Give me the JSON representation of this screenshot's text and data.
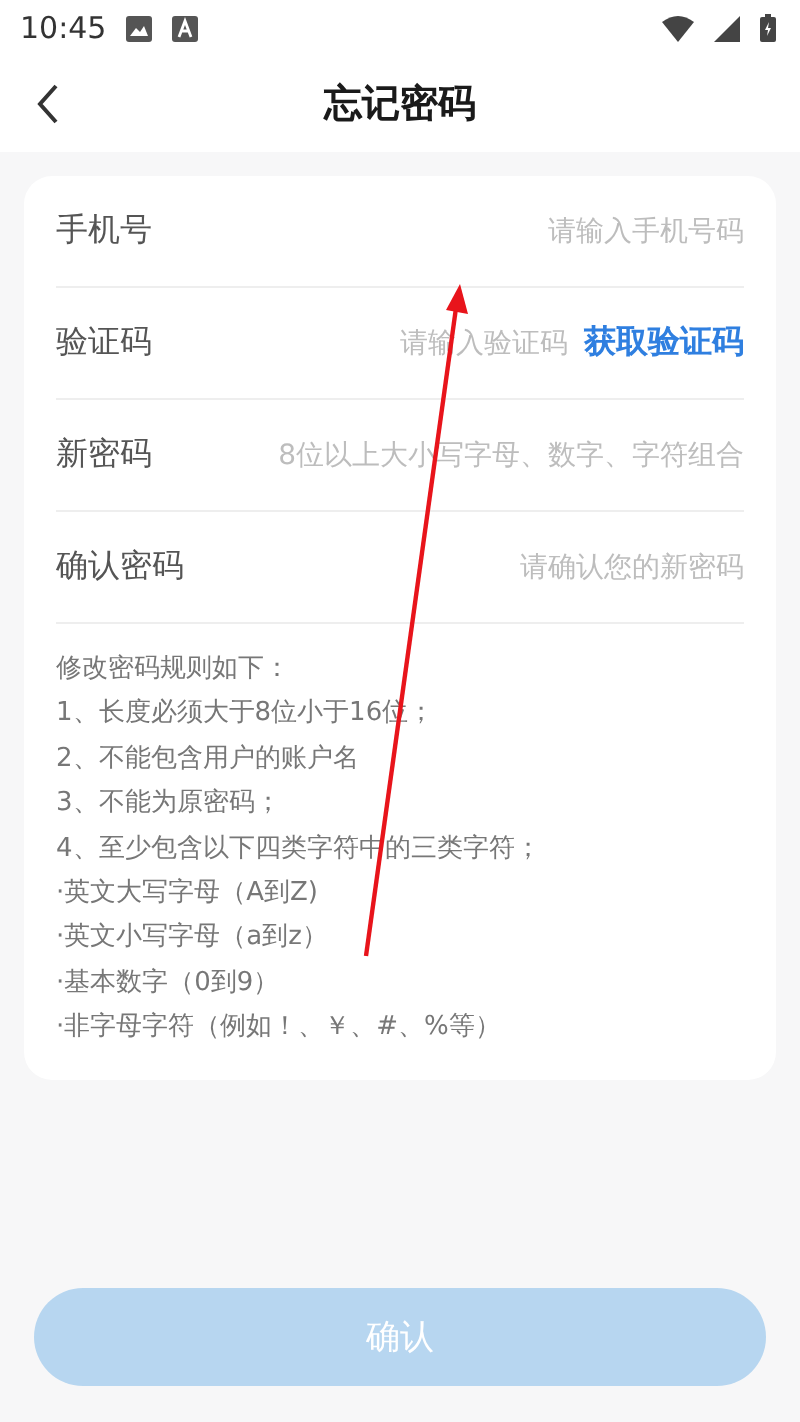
{
  "status_bar": {
    "time": "10:45"
  },
  "header": {
    "title": "忘记密码"
  },
  "fields": [
    {
      "kind": "text",
      "label": "手机号",
      "placeholder": "请输入手机号码"
    },
    {
      "kind": "code",
      "label": "验证码",
      "placeholder": "请输入验证码",
      "action": "获取验证码"
    },
    {
      "kind": "text",
      "label": "新密码",
      "placeholder": "8位以上大小写字母、数字、字符组合"
    },
    {
      "kind": "text",
      "label": "确认密码",
      "placeholder": "请确认您的新密码"
    }
  ],
  "rules": [
    "修改密码规则如下：",
    "1、长度必须大于8位小于16位；",
    "2、不能包含用户的账户名",
    "3、不能为原密码；",
    "4、至少包含以下四类字符中的三类字符；",
    "·英文大写字母（A到Z)",
    "·英文小写字母（a到z）",
    "·基本数字（0到9）",
    "·非字母字符（例如！、￥、#、%等）"
  ],
  "confirm_button": {
    "label": "确认",
    "disabled": true
  }
}
